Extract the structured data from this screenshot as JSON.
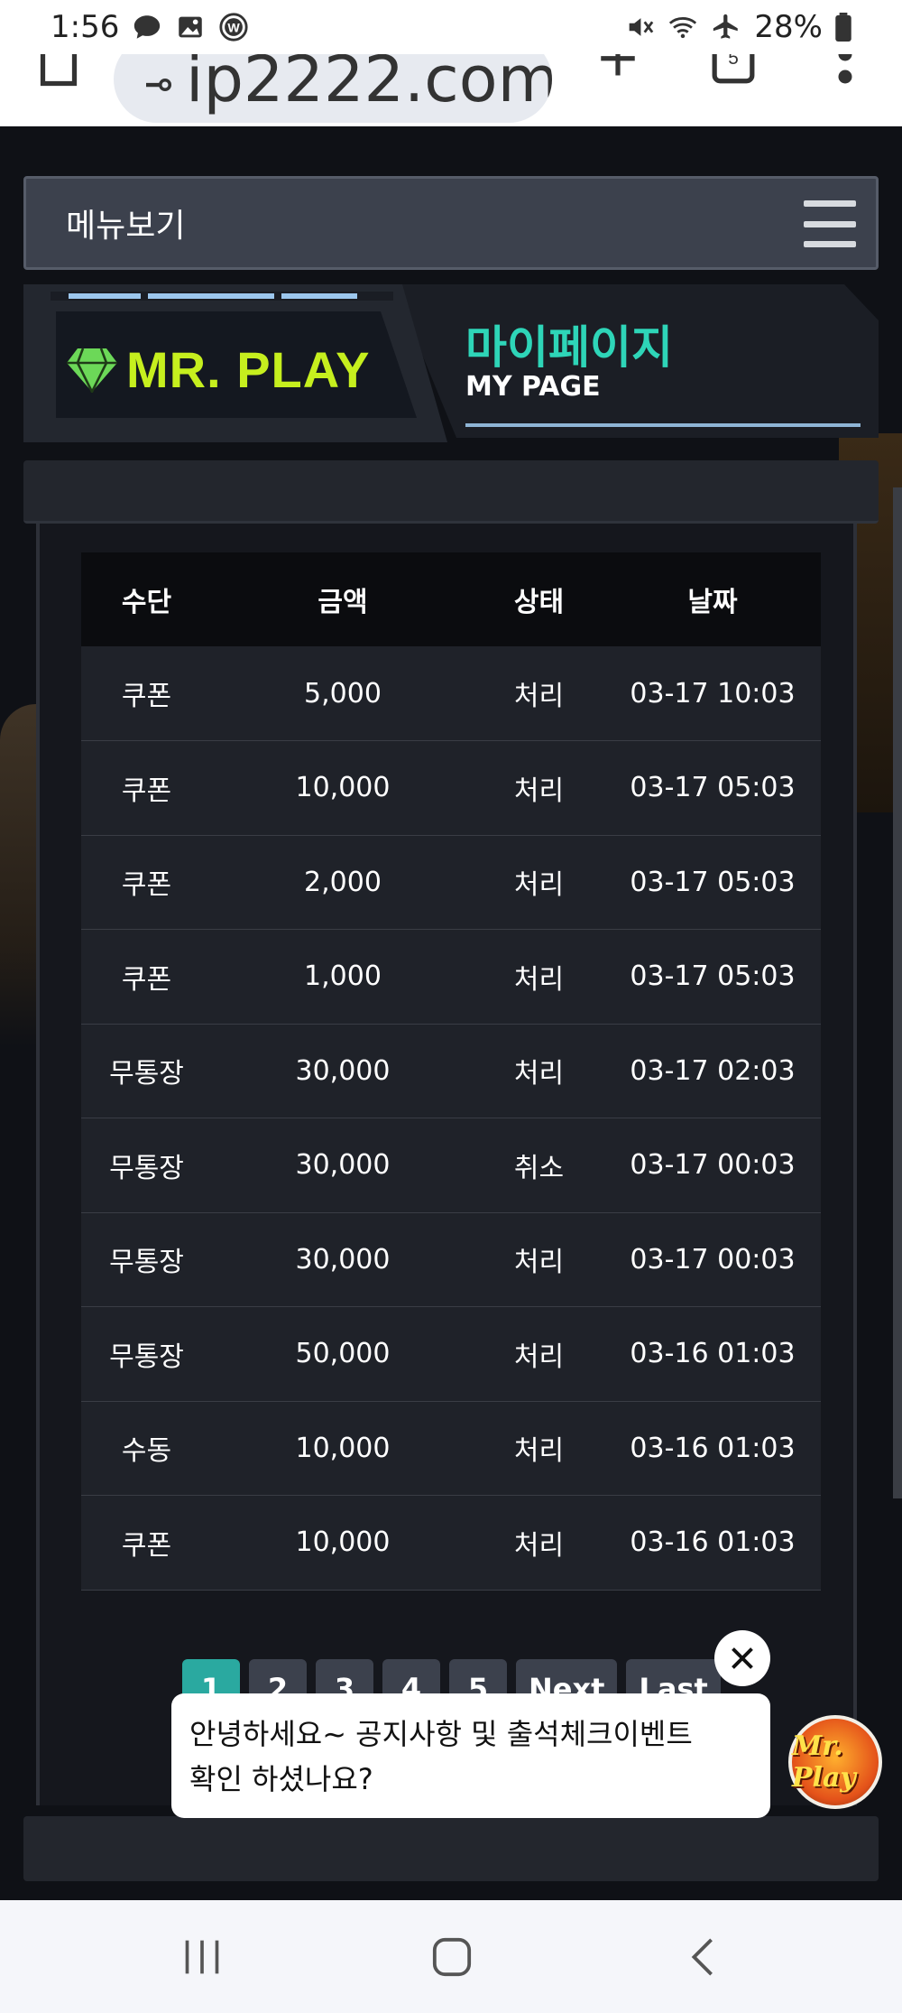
{
  "status_bar": {
    "time": "1:56",
    "battery": "28%",
    "icons": [
      "chat-bubble-icon",
      "gallery-icon",
      "w-app-icon",
      "mute-icon",
      "wifi-icon",
      "airplane-icon",
      "battery-icon"
    ]
  },
  "browser": {
    "url": "ip2222.com",
    "tab_count": "5"
  },
  "menu": {
    "label": "메뉴보기"
  },
  "banner": {
    "logo_text": "MR. PLAY",
    "title_ko": "마이페이지",
    "title_en": "MY PAGE"
  },
  "table": {
    "headers": [
      "수단",
      "금액",
      "상태",
      "날짜"
    ],
    "rows": [
      [
        "쿠폰",
        "5,000",
        "처리",
        "03-17 10:03"
      ],
      [
        "쿠폰",
        "10,000",
        "처리",
        "03-17 05:03"
      ],
      [
        "쿠폰",
        "2,000",
        "처리",
        "03-17 05:03"
      ],
      [
        "쿠폰",
        "1,000",
        "처리",
        "03-17 05:03"
      ],
      [
        "무통장",
        "30,000",
        "처리",
        "03-17 02:03"
      ],
      [
        "무통장",
        "30,000",
        "취소",
        "03-17 00:03"
      ],
      [
        "무통장",
        "30,000",
        "처리",
        "03-17 00:03"
      ],
      [
        "무통장",
        "50,000",
        "처리",
        "03-16 01:03"
      ],
      [
        "수동",
        "10,000",
        "처리",
        "03-16 01:03"
      ],
      [
        "쿠폰",
        "10,000",
        "처리",
        "03-16 01:03"
      ]
    ]
  },
  "pagination": {
    "pages": [
      "1",
      "2",
      "3",
      "4",
      "5"
    ],
    "active": "1",
    "next_label": "Next",
    "last_label": "Last"
  },
  "chat": {
    "message_line1": "안녕하세요~ 공지사항 및 출석체크이벤트",
    "message_line2": "확인 하셨나요?",
    "avatar_text": "Mr. Play"
  },
  "colors": {
    "accent": "#2aa9a0",
    "logo": "#c6ef1e",
    "mypage": "#2ed5b8"
  }
}
